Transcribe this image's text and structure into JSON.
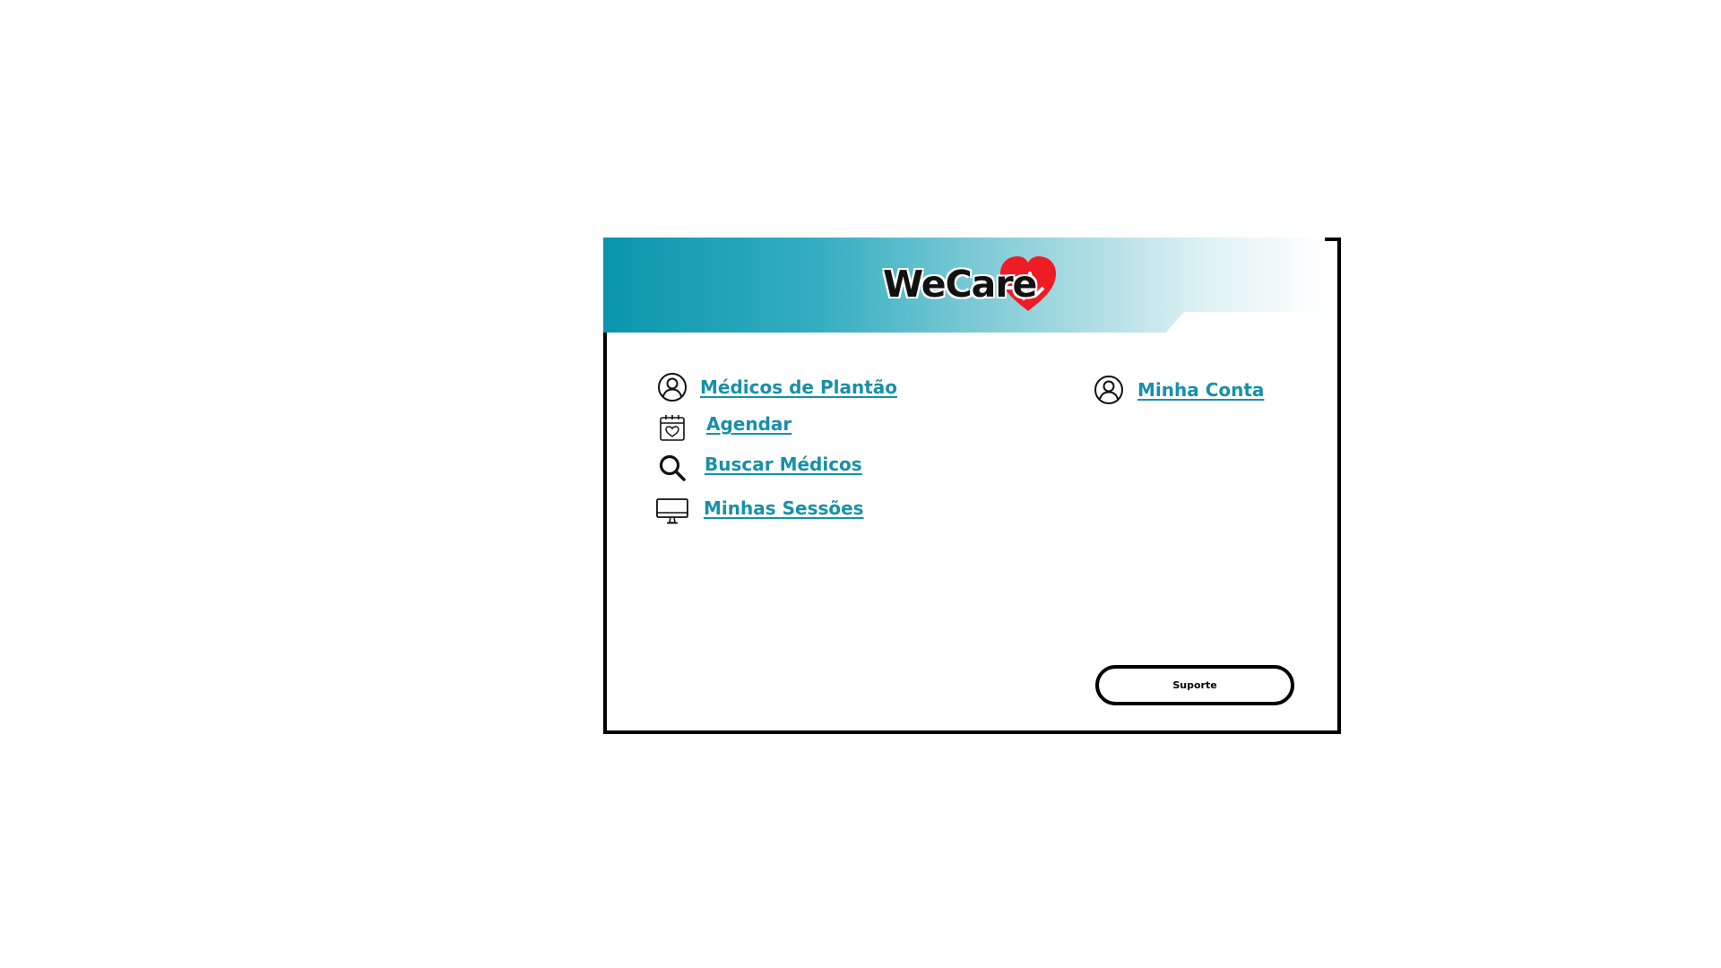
{
  "brand": {
    "name": "WeCare",
    "heart_color": "#ee1c25",
    "header_accent": "#0a95ad"
  },
  "nav": {
    "items": [
      {
        "label": "Médicos de Plantão",
        "icon": "user-circle-icon"
      },
      {
        "label": "Agendar",
        "icon": "calendar-heart-icon"
      },
      {
        "label": "Buscar Médicos",
        "icon": "search-icon"
      },
      {
        "label": "Minhas Sessões",
        "icon": "monitor-icon"
      }
    ]
  },
  "account": {
    "label": "Minha Conta",
    "icon": "user-circle-icon"
  },
  "support": {
    "label": "Suporte"
  },
  "colors": {
    "link": "#1890a8",
    "border": "#000000"
  }
}
